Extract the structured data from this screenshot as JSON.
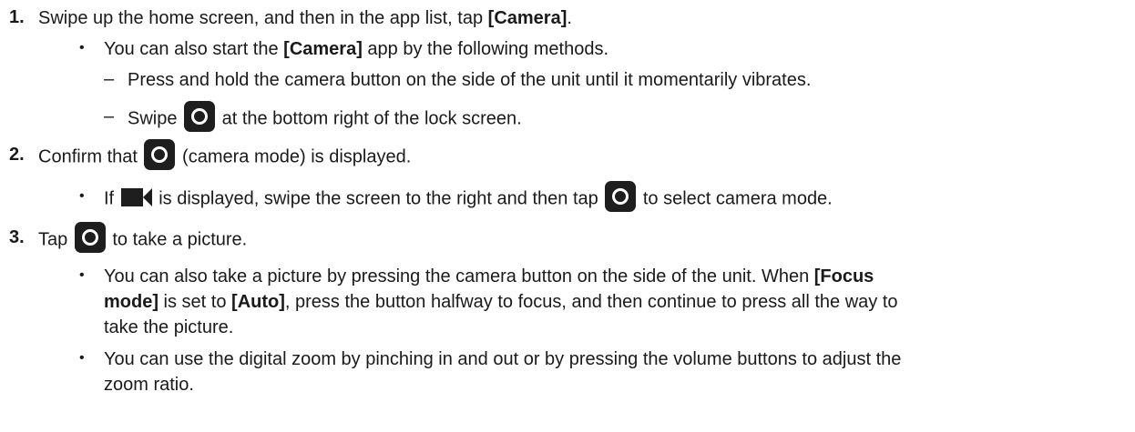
{
  "steps": [
    {
      "number": "1.",
      "text_before": "Swipe up the home screen, and then in the app list, tap ",
      "bold": "[Camera]",
      "text_after": ".",
      "bullet": {
        "before": "You can also start the ",
        "bold": "[Camera]",
        "after": " app by the following methods.",
        "dashes": [
          "Press and hold the camera button on the side of the unit until it momentarily vibrates.",
          {
            "before": "Swipe ",
            "icon": "camera-shutter-icon",
            "after": " at the bottom right of the lock screen."
          }
        ]
      }
    },
    {
      "number": "2.",
      "before": "Confirm that ",
      "icon": "camera-shutter-icon",
      "after": " (camera mode) is displayed.",
      "bullet": {
        "before": "If ",
        "icon1": "video-camera-icon",
        "middle": " is displayed, swipe the screen to the right and then tap ",
        "icon2": "camera-shutter-icon",
        "after": " to select camera mode."
      }
    },
    {
      "number": "3.",
      "before": "Tap ",
      "icon": "camera-shutter-icon",
      "after": " to take a picture.",
      "bullets": [
        {
          "line1_before": "You can also take a picture by pressing the camera button on the side of the unit. When ",
          "line1_bold": "[Focus",
          "line2_bold1": "mode]",
          "line2_mid": " is set to ",
          "line2_bold2": "[Auto]",
          "line2_after": ", press the button halfway to focus, and then continue to press all the way to",
          "line3": "take the picture."
        },
        {
          "line1": "You can use the digital zoom by pinching in and out or by pressing the volume buttons to adjust the",
          "line2": "zoom ratio."
        }
      ]
    }
  ],
  "bullet_glyph": "•",
  "dash_glyph": "–"
}
